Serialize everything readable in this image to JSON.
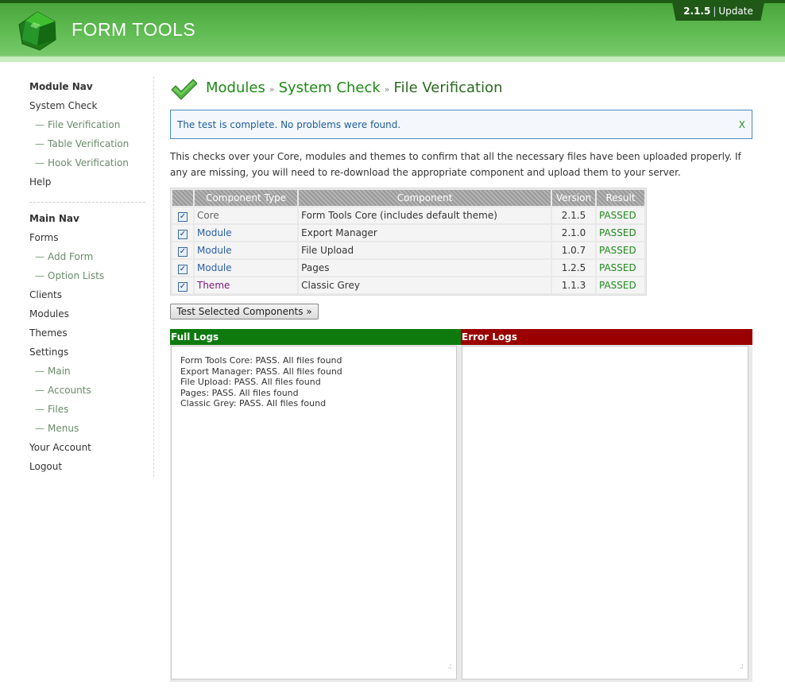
{
  "header": {
    "logo_text": "FORM TOOLS",
    "version": "2.1.5",
    "separator": "|",
    "update_label": "Update"
  },
  "sidebar": {
    "module_nav_title": "Module Nav",
    "module_nav": [
      {
        "label": "System Check",
        "sub": false
      },
      {
        "label": "File Verification",
        "sub": true
      },
      {
        "label": "Table Verification",
        "sub": true
      },
      {
        "label": "Hook Verification",
        "sub": true
      },
      {
        "label": "Help",
        "sub": false
      }
    ],
    "main_nav_title": "Main Nav",
    "main_nav": [
      {
        "label": "Forms",
        "sub": false
      },
      {
        "label": "Add Form",
        "sub": true
      },
      {
        "label": "Option Lists",
        "sub": true
      },
      {
        "label": "Clients",
        "sub": false
      },
      {
        "label": "Modules",
        "sub": false
      },
      {
        "label": "Themes",
        "sub": false
      },
      {
        "label": "Settings",
        "sub": false
      },
      {
        "label": "Main",
        "sub": true
      },
      {
        "label": "Accounts",
        "sub": true
      },
      {
        "label": "Files",
        "sub": true
      },
      {
        "label": "Menus",
        "sub": true
      },
      {
        "label": "Your Account",
        "sub": false
      },
      {
        "label": "Logout",
        "sub": false
      }
    ],
    "sub_prefix": "—"
  },
  "breadcrumb": {
    "items": [
      "Modules",
      "System Check"
    ],
    "separator": "»",
    "current": "File Verification"
  },
  "notice": {
    "message": "The test is complete. No problems were found.",
    "close_label": "X"
  },
  "description": "This checks over your Core, modules and themes to confirm that all the necessary files have been uploaded properly. If any are missing, you will need to re-download the appropriate component and upload them to your server.",
  "table": {
    "headers": [
      "",
      "Component Type",
      "Component",
      "Version",
      "Result"
    ],
    "rows": [
      {
        "type": "Core",
        "component": "Form Tools Core (includes default theme)",
        "version": "2.1.5",
        "result": "PASSED",
        "checked": true
      },
      {
        "type": "Module",
        "component": "Export Manager",
        "version": "2.1.0",
        "result": "PASSED",
        "checked": true
      },
      {
        "type": "Module",
        "component": "File Upload",
        "version": "1.0.7",
        "result": "PASSED",
        "checked": true
      },
      {
        "type": "Module",
        "component": "Pages",
        "version": "1.2.5",
        "result": "PASSED",
        "checked": true
      },
      {
        "type": "Theme",
        "component": "Classic Grey",
        "version": "1.1.3",
        "result": "PASSED",
        "checked": true
      }
    ]
  },
  "test_button_label": "Test Selected Components »",
  "logs": {
    "full_title": "Full Logs",
    "error_title": "Error Logs",
    "full_text": "Form Tools Core: PASS. All files found\nExport Manager: PASS. All files found\nFile Upload: PASS. All files found\nPages: PASS. All files found\nClassic Grey: PASS. All files found",
    "error_text": ""
  },
  "colors": {
    "brand_green": "#4aa63d",
    "full_logs_green": "#0e7a0e",
    "error_logs_red": "#9a0000",
    "passed_green": "#1f8a1f"
  }
}
